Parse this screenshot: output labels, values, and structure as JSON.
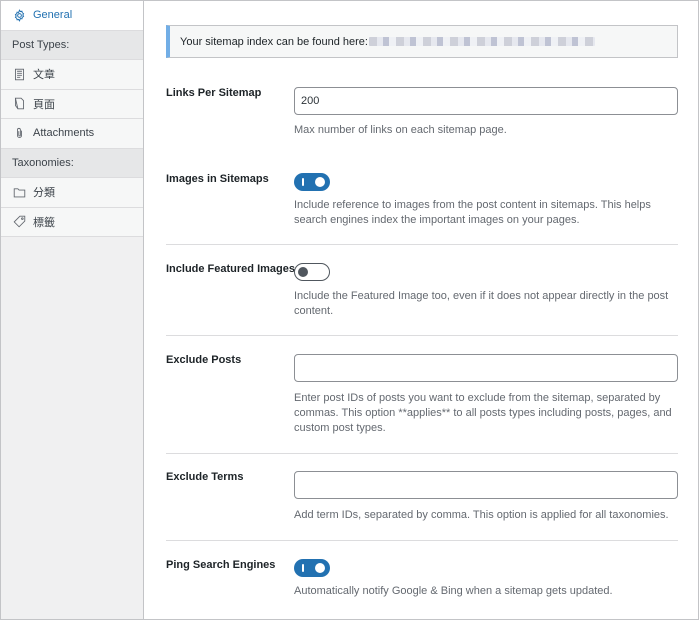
{
  "sidebar": {
    "general": "General",
    "post_types_heading": "Post Types:",
    "post_types": [
      "文章",
      "頁面",
      "Attachments"
    ],
    "taxonomies_heading": "Taxonomies:",
    "taxonomies": [
      "分類",
      "標籤"
    ]
  },
  "notice": {
    "text": "Your sitemap index can be found here:"
  },
  "settings": {
    "links_per_sitemap": {
      "label": "Links Per Sitemap",
      "value": "200",
      "description": "Max number of links on each sitemap page."
    },
    "images_in_sitemaps": {
      "label": "Images in Sitemaps",
      "enabled": true,
      "description": "Include reference to images from the post content in sitemaps. This helps search engines index the important images on your pages."
    },
    "include_featured_images": {
      "label": "Include Featured Images",
      "enabled": false,
      "description": "Include the Featured Image too, even if it does not appear directly in the post content."
    },
    "exclude_posts": {
      "label": "Exclude Posts",
      "value": "",
      "description": "Enter post IDs of posts you want to exclude from the sitemap, separated by commas. This option **applies** to all posts types including posts, pages, and custom post types."
    },
    "exclude_terms": {
      "label": "Exclude Terms",
      "value": "",
      "description": "Add term IDs, separated by comma. This option is applied for all taxonomies."
    },
    "ping_search_engines": {
      "label": "Ping Search Engines",
      "enabled": true,
      "description": "Automatically notify Google & Bing when a sitemap gets updated."
    }
  },
  "colors": {
    "accent": "#2271b1",
    "sidebar_bg": "#f0f0f1"
  },
  "icons": {
    "general": "gear-icon",
    "post_type_article": "document-icon",
    "post_type_page": "page-icon",
    "attachments": "paperclip-icon",
    "category": "folder-icon",
    "tag": "tag-icon"
  }
}
